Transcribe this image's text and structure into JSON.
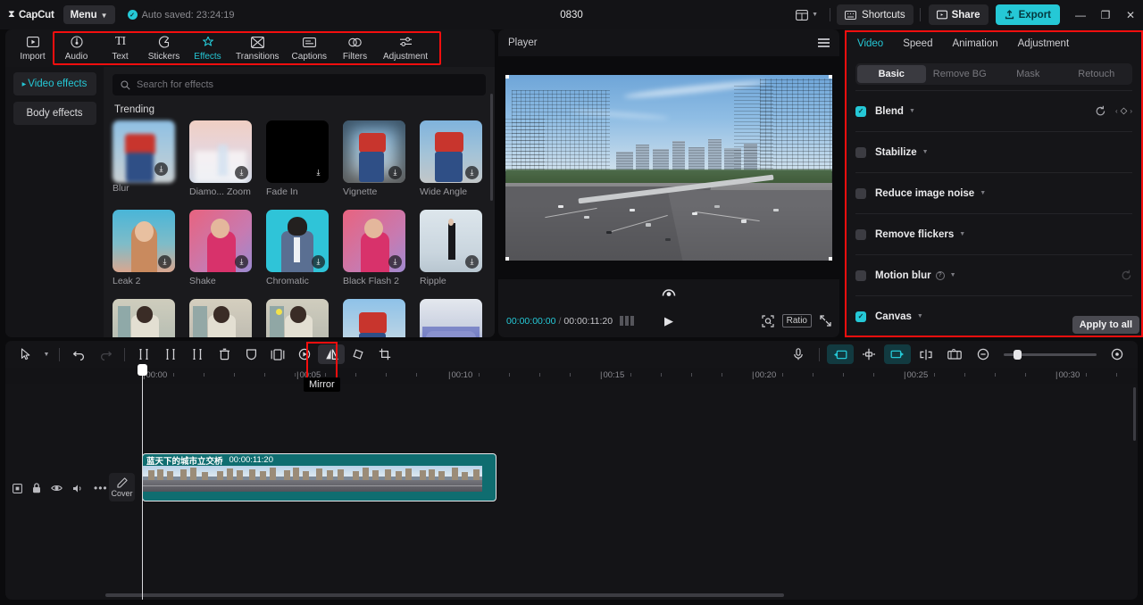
{
  "titlebar": {
    "brand": "CapCut",
    "menu_label": "Menu",
    "autosave_text": "Auto saved: 23:24:19",
    "project_title": "0830",
    "shortcuts_label": "Shortcuts",
    "share_label": "Share",
    "export_label": "Export",
    "minimize": "—",
    "maximize": "❐",
    "close": "✕"
  },
  "nav": {
    "items": [
      {
        "label": "Import",
        "icon": "import-icon",
        "active": false
      },
      {
        "label": "Audio",
        "icon": "audio-icon",
        "active": false
      },
      {
        "label": "Text",
        "icon": "text-icon",
        "active": false
      },
      {
        "label": "Stickers",
        "icon": "stickers-icon",
        "active": false
      },
      {
        "label": "Effects",
        "icon": "effects-icon",
        "active": true
      },
      {
        "label": "Transitions",
        "icon": "transitions-icon",
        "active": false
      },
      {
        "label": "Captions",
        "icon": "captions-icon",
        "active": false
      },
      {
        "label": "Filters",
        "icon": "filters-icon",
        "active": false
      },
      {
        "label": "Adjustment",
        "icon": "adjustment-icon",
        "active": false
      }
    ]
  },
  "effects_panel": {
    "sidebar": [
      {
        "label": "Video effects",
        "active": true
      },
      {
        "label": "Body effects",
        "active": false
      }
    ],
    "search_placeholder": "Search for effects",
    "section_title": "Trending",
    "items": [
      {
        "label": "Blur"
      },
      {
        "label": "Diamo... Zoom"
      },
      {
        "label": "Fade In"
      },
      {
        "label": "Vignette"
      },
      {
        "label": "Wide Angle"
      },
      {
        "label": "Leak 2"
      },
      {
        "label": "Shake"
      },
      {
        "label": "Chromatic"
      },
      {
        "label": "Black Flash 2"
      },
      {
        "label": "Ripple"
      },
      {
        "label": ""
      },
      {
        "label": ""
      },
      {
        "label": ""
      },
      {
        "label": ""
      },
      {
        "label": ""
      }
    ]
  },
  "player": {
    "title": "Player",
    "current_time": "00:00:00:00",
    "separator": "/",
    "total_time": "00:00:11:20",
    "ratio_label": "Ratio",
    "play_icon": "▶"
  },
  "right_panel": {
    "tabs": [
      {
        "label": "Video",
        "active": true
      },
      {
        "label": "Speed",
        "active": false
      },
      {
        "label": "Animation",
        "active": false
      },
      {
        "label": "Adjustment",
        "active": false
      }
    ],
    "segments": [
      {
        "label": "Basic",
        "active": true
      },
      {
        "label": "Remove BG",
        "active": false
      },
      {
        "label": "Mask",
        "active": false
      },
      {
        "label": "Retouch",
        "active": false
      }
    ],
    "properties": [
      {
        "label": "Blend",
        "checked": true,
        "has_reset": true,
        "has_keyframe": true,
        "has_help": false
      },
      {
        "label": "Stabilize",
        "checked": false,
        "has_reset": false,
        "has_keyframe": false,
        "has_help": false
      },
      {
        "label": "Reduce image noise",
        "checked": false,
        "has_reset": false,
        "has_keyframe": false,
        "has_help": false
      },
      {
        "label": "Remove flickers",
        "checked": false,
        "has_reset": false,
        "has_keyframe": false,
        "has_help": false
      },
      {
        "label": "Motion blur",
        "checked": false,
        "has_reset": true,
        "has_keyframe": false,
        "has_help": true
      },
      {
        "label": "Canvas",
        "checked": true,
        "has_reset": false,
        "has_keyframe": false,
        "has_help": false
      }
    ],
    "apply_to_all_label": "Apply to all"
  },
  "timeline": {
    "tooltip": "Mirror",
    "ruler_labels": [
      "00:00",
      "00:05",
      "00:10",
      "00:15",
      "00:20",
      "00:25",
      "00:30"
    ],
    "cover_label": "Cover",
    "clip": {
      "name": "蓝天下的城市立交桥",
      "duration": "00:00:11:20"
    },
    "tools": [
      {
        "name": "select-tool",
        "glyph": "⌖"
      },
      {
        "name": "split-tool",
        "glyph": "]["
      },
      {
        "name": "trim-left-tool",
        "glyph": "]["
      },
      {
        "name": "trim-right-tool",
        "glyph": "]["
      },
      {
        "name": "delete-tool",
        "glyph": "🗑"
      },
      {
        "name": "freeze-tool",
        "glyph": "⬠"
      },
      {
        "name": "crop-mirror-tool",
        "glyph": "|□|"
      },
      {
        "name": "reverse-tool",
        "glyph": "◑"
      },
      {
        "name": "mirror-tool",
        "glyph": "◪"
      },
      {
        "name": "rotate-tool",
        "glyph": "◇"
      },
      {
        "name": "crop-tool",
        "glyph": "⬛"
      }
    ]
  },
  "colors": {
    "accent": "#25c8d6",
    "highlight_box": "#f40e0e",
    "clip_bg": "#0f6d70",
    "panel_bg": "#151518"
  }
}
